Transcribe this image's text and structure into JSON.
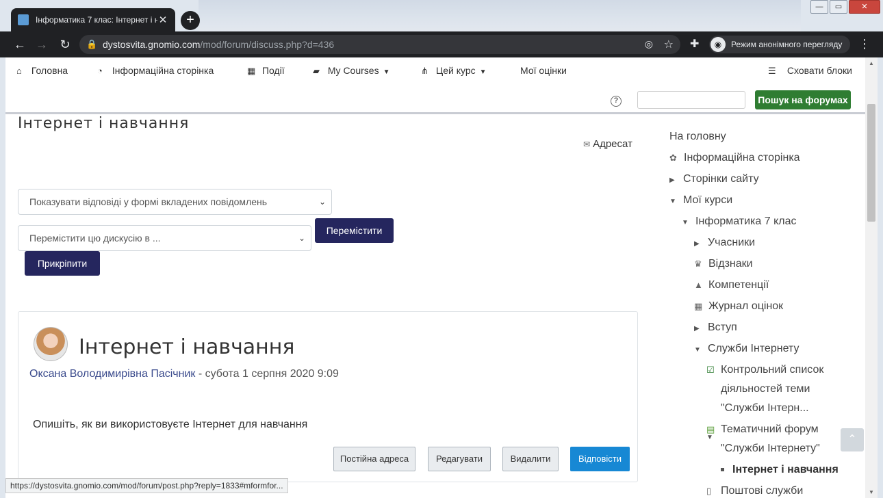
{
  "browser": {
    "tab_title": "Інформатика 7 клас: Інтернет і н",
    "tab_close": "✕",
    "new_tab": "+",
    "url_host": "dystosvita.gnomio.com",
    "url_path": "/mod/forum/discuss.php?d=436",
    "incognito_label": "Режим анонімного перегляду",
    "status_url": "https://dystosvita.gnomio.com/mod/forum/post.php?reply=1833#mformfor..."
  },
  "topnav": {
    "home": "Головна",
    "dashboard": "Інформаційна сторінка",
    "events": "Події",
    "my_courses": "My Courses",
    "this_course": "Цей курс",
    "grades": "Мої оцінки",
    "hide_blocks": "Сховати блоки"
  },
  "forum_search": {
    "placeholder": "",
    "button": "Пошук на форумах"
  },
  "main": {
    "title": "Інтернет і навчання",
    "recipient": "Адресат",
    "display_mode": "Показувати відповіді у формі вкладених повідомлень",
    "move_select": "Перемістити цю дискусію в ...",
    "move_button": "Перемістити",
    "pin_button": "Прикріпити"
  },
  "post": {
    "title": "Інтернет і навчання",
    "author": "Оксана Володимирівна Пасічник",
    "date": " - субота 1 серпня 2020 9:09",
    "body": "Опишіть, як ви використовуєте Інтернет для навчання",
    "permalink": "Постійна адреса",
    "edit": "Редагувати",
    "delete": "Видалити",
    "reply": "Відповісти"
  },
  "sidebar": {
    "home": "На головну",
    "dashboard": "Інформаційна сторінка",
    "site_pages": "Сторінки сайту",
    "my_courses": "Мої курси",
    "course": "Інформатика 7 клас",
    "participants": "Учасники",
    "badges": "Відзнаки",
    "competencies": "Компетенції",
    "grades": "Журнал оцінок",
    "intro": "Вступ",
    "internet_services": "Служби Інтернету",
    "checklist_1": "Контрольний список",
    "checklist_2": "діяльностей теми",
    "checklist_3": "\"Служби Інтерн...",
    "forum_1": "Тематичний форум",
    "forum_2": "\"Служби Інтернету\"",
    "current": "Інтернет і навчання",
    "mail": "Поштові служби"
  }
}
